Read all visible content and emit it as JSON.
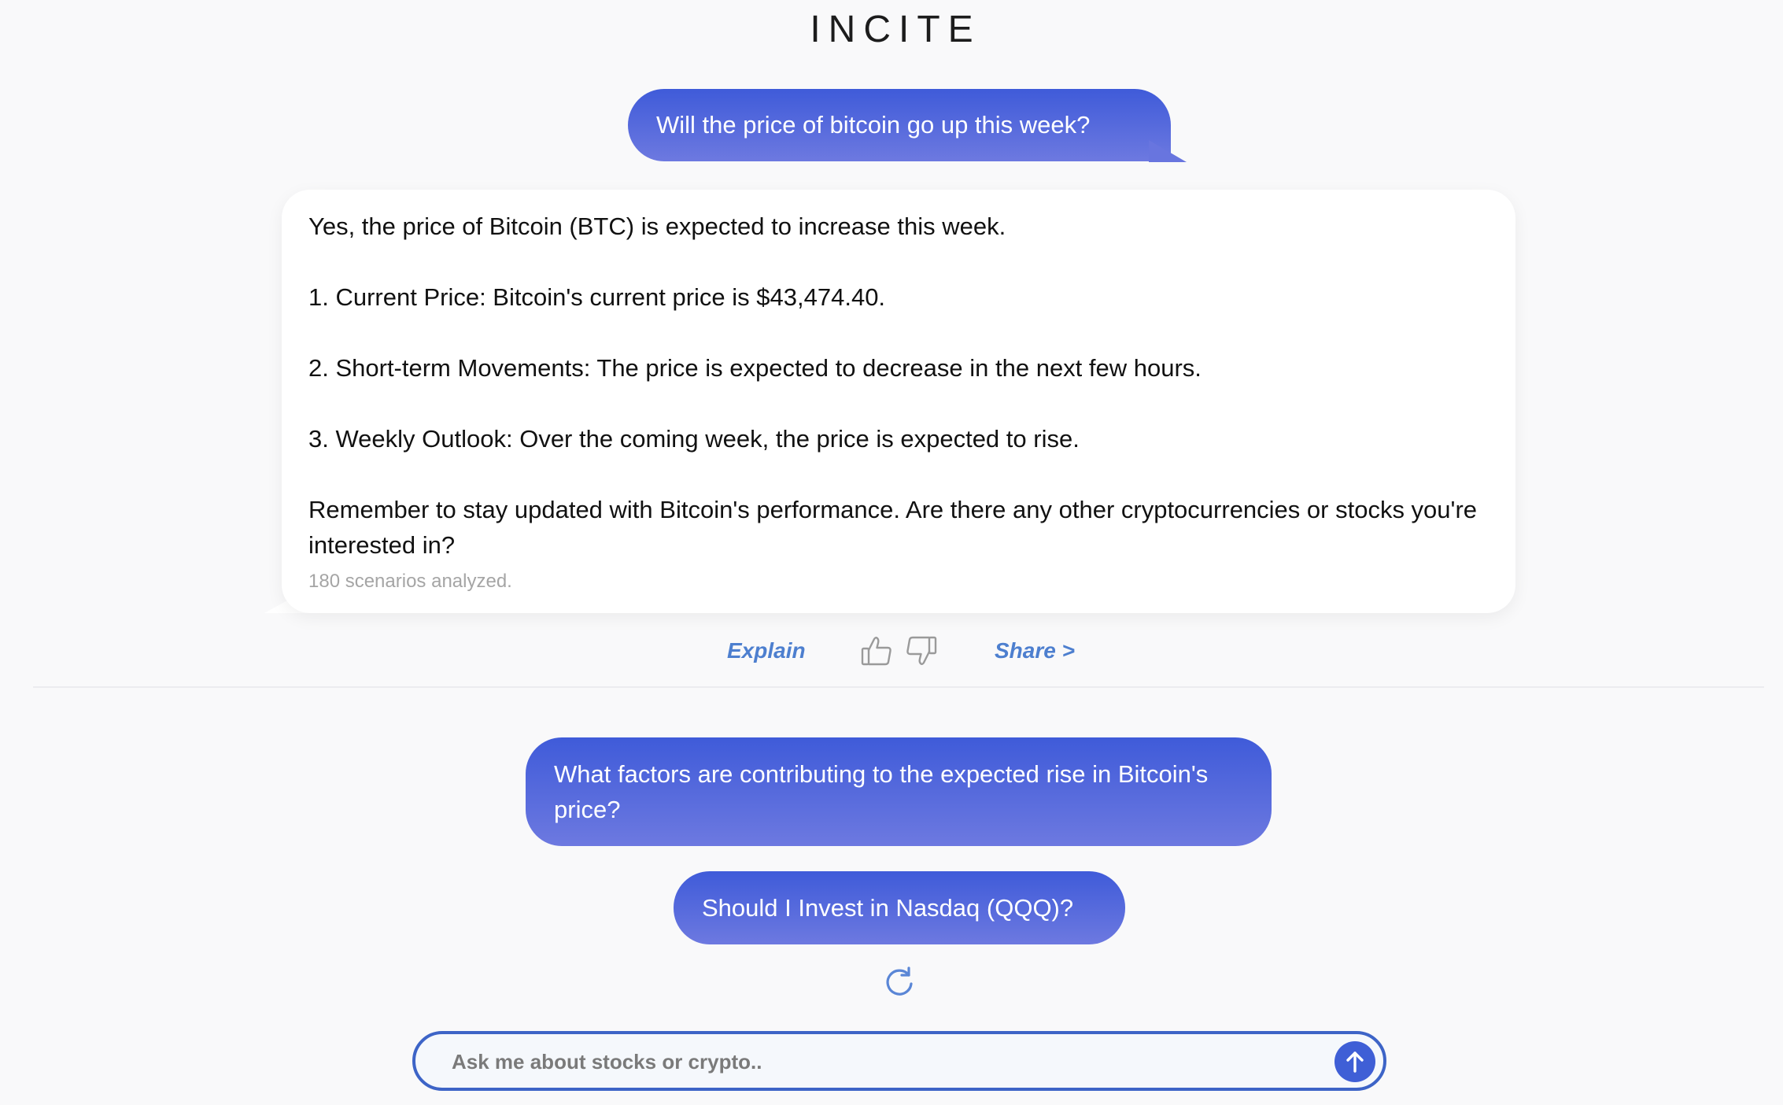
{
  "header": {
    "logo": "INCITE"
  },
  "conversation": {
    "user_question": "Will the price of bitcoin go up this week?",
    "bot_answer": {
      "lines": [
        "Yes, the price of Bitcoin (BTC) is expected to increase this week.",
        "1. Current Price: Bitcoin's current price is $43,474.40.",
        "2. Short-term Movements: The price is expected to decrease in the next few hours.",
        "3. Weekly Outlook: Over the coming week, the price is expected to rise.",
        "Remember to stay updated with Bitcoin's performance. Are there any other cryptocurrencies or stocks you're interested in?"
      ],
      "footnote": "180 scenarios analyzed."
    }
  },
  "actions": {
    "explain_label": "Explain",
    "share_label": "Share >",
    "thumbs_up_icon": "thumbs-up-icon",
    "thumbs_down_icon": "thumbs-down-icon"
  },
  "suggestions": [
    "What factors are contributing to the expected rise in Bitcoin's price?",
    "Should I Invest in Nasdaq (QQQ)?"
  ],
  "refresh_icon": "refresh-icon",
  "input": {
    "placeholder": "Ask me about stocks or crypto..",
    "value": "",
    "send_icon": "arrow-up-icon"
  },
  "colors": {
    "accent": "#3f5bd9",
    "accent_light": "#6d79e0",
    "link": "#4d7fcf",
    "background": "#f9f9fa"
  }
}
